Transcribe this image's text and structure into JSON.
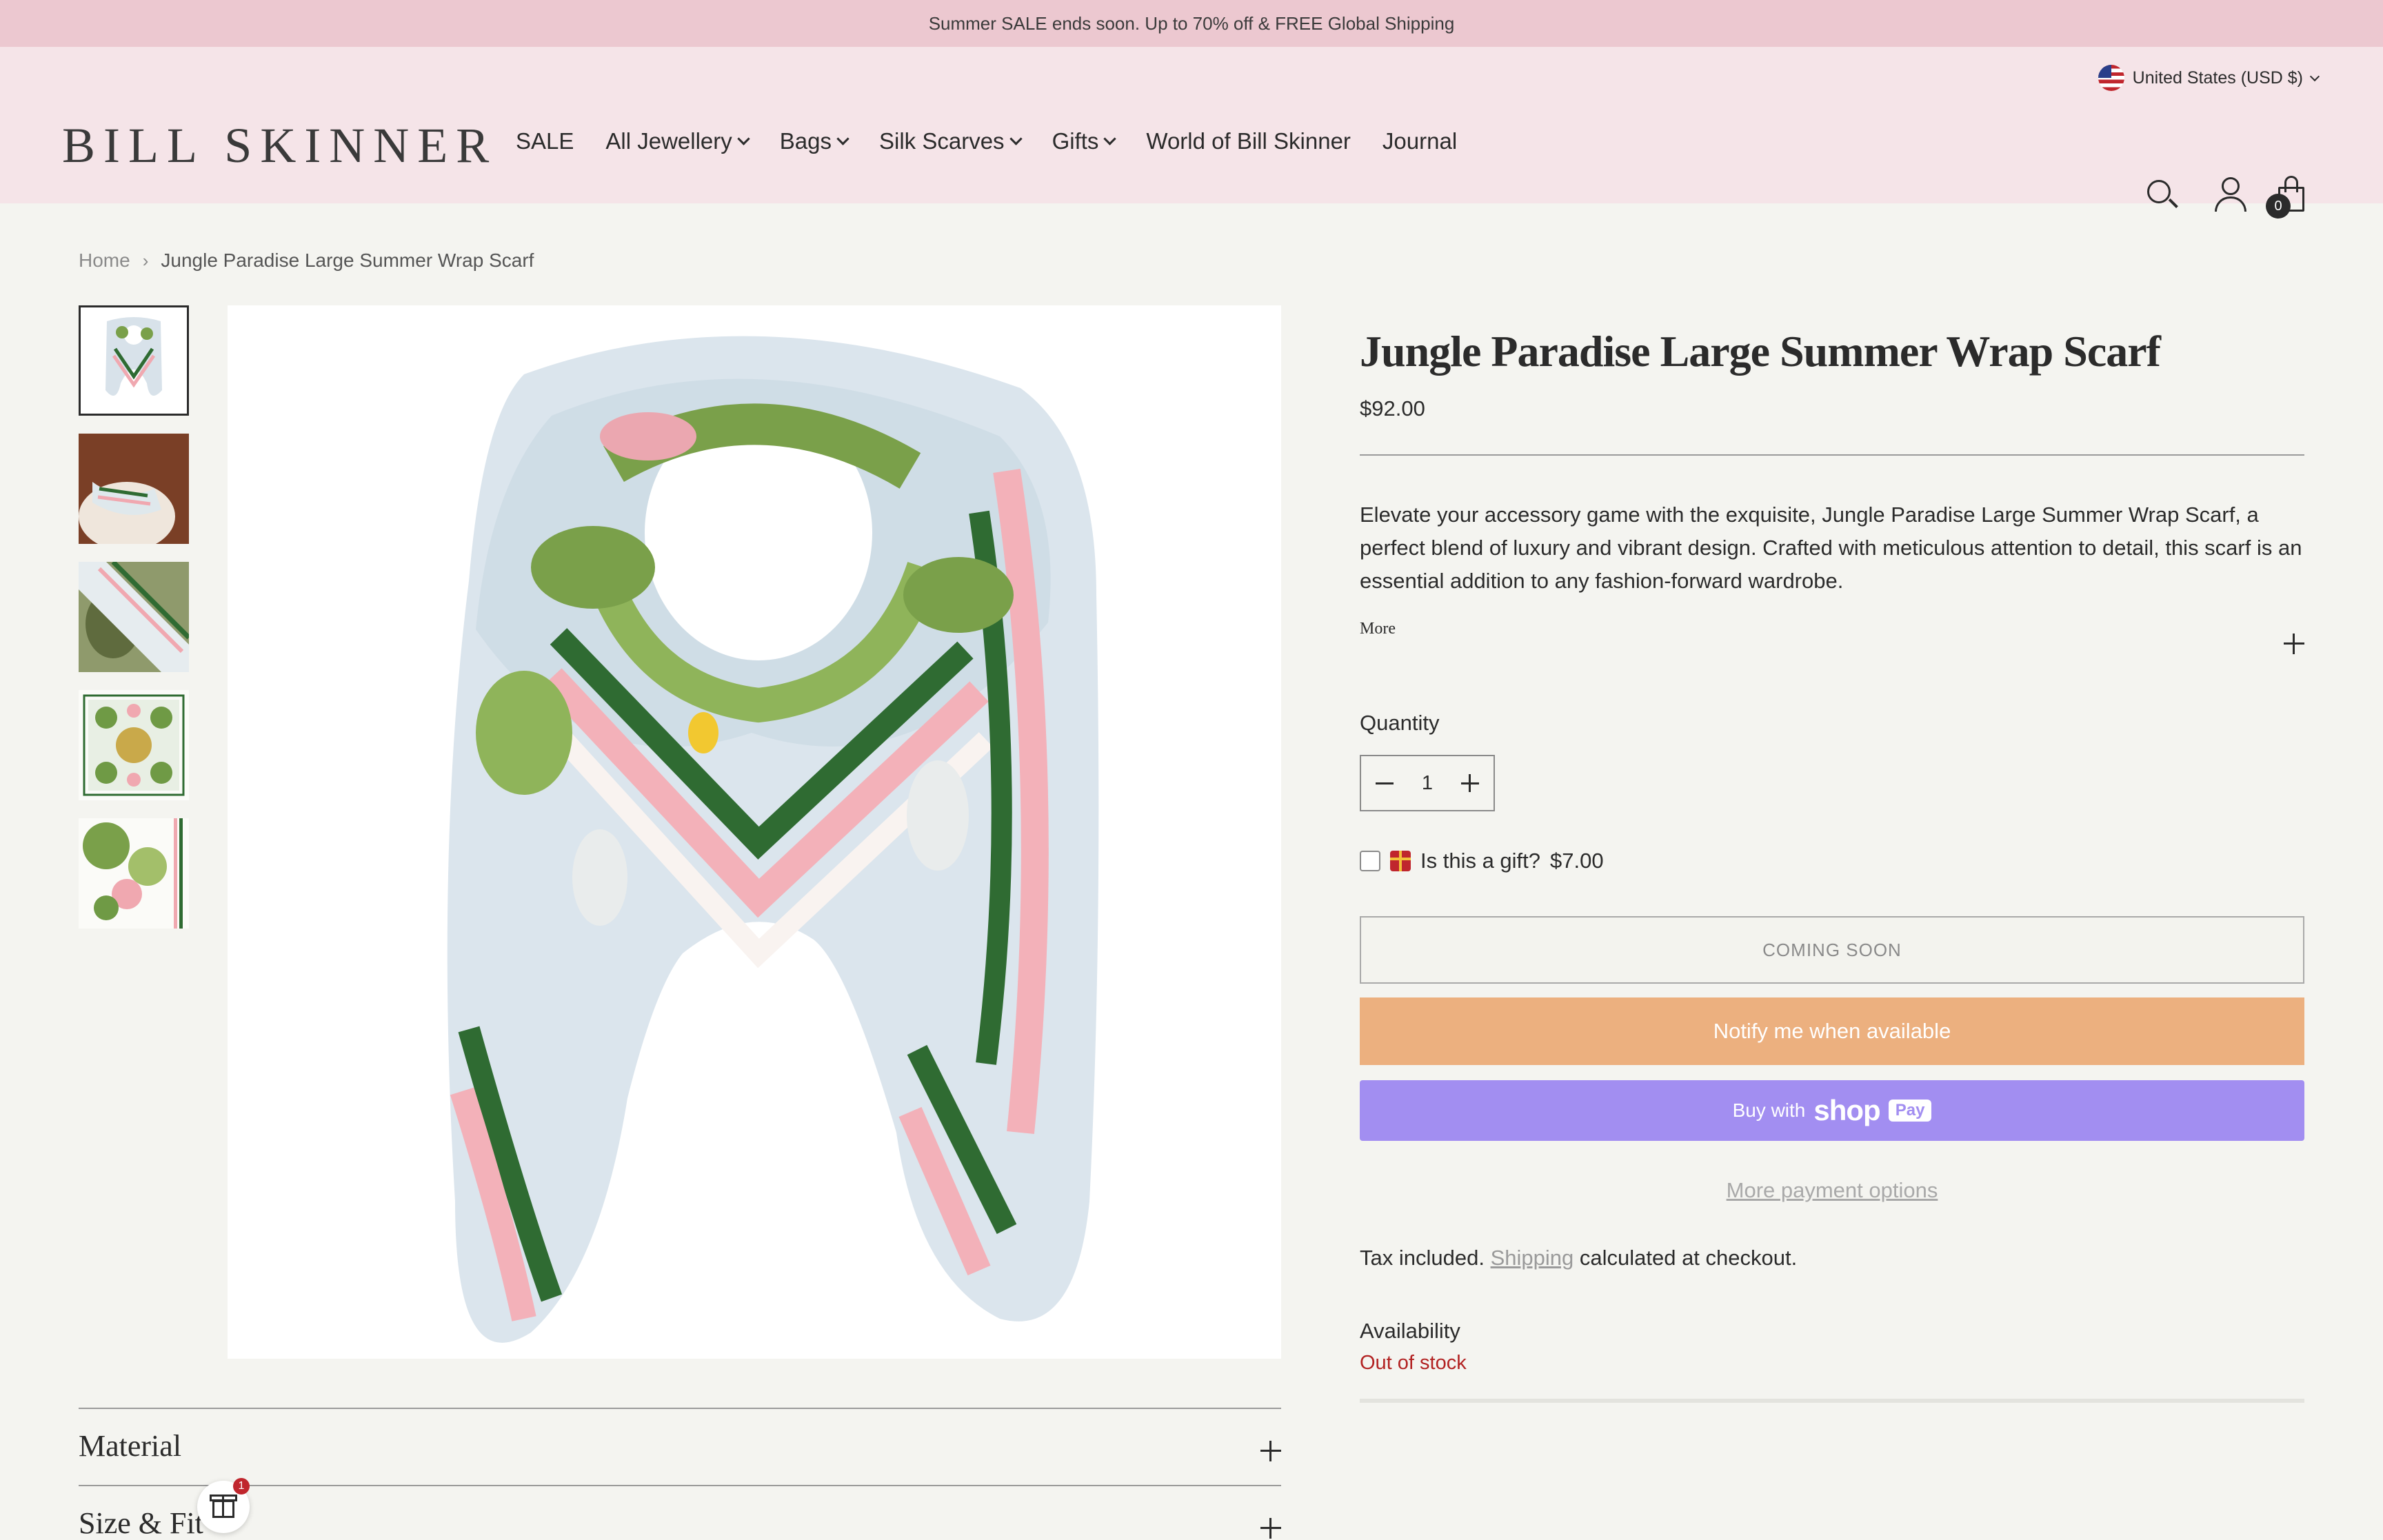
{
  "announcement": "Summer SALE ends soon. Up to 70% off & FREE Global Shipping",
  "header": {
    "locale": "United States (USD $)",
    "logo": "Bill Skinner",
    "nav": [
      {
        "label": "SALE",
        "dropdown": false
      },
      {
        "label": "All Jewellery",
        "dropdown": true
      },
      {
        "label": "Bags",
        "dropdown": true
      },
      {
        "label": "Silk Scarves",
        "dropdown": true
      },
      {
        "label": "Gifts",
        "dropdown": true
      },
      {
        "label": "World of Bill Skinner",
        "dropdown": false
      },
      {
        "label": "Journal",
        "dropdown": false
      }
    ],
    "cart_count": "0"
  },
  "breadcrumb": {
    "home": "Home",
    "current": "Jungle Paradise Large Summer Wrap Scarf"
  },
  "product": {
    "title": "Jungle Paradise Large Summer Wrap Scarf",
    "price": "$92.00",
    "description": "Elevate your accessory game with the exquisite, Jungle Paradise Large Summer Wrap Scarf, a perfect blend of luxury and vibrant design. Crafted with meticulous attention to detail, this scarf is an essential addition to any fashion-forward wardrobe.",
    "more_label": "More",
    "quantity_label": "Quantity",
    "quantity": "1",
    "gift_label": "Is this a gift?",
    "gift_price": "$7.00",
    "coming_soon": "COMING SOON",
    "notify": "Notify me when available",
    "buy_with": "Buy with",
    "shop_word": "shop",
    "pay_badge": "Pay",
    "more_payment": "More payment options",
    "tax_prefix": "Tax included.",
    "tax_link": "Shipping",
    "tax_suffix": "calculated at checkout.",
    "availability_label": "Availability",
    "availability": "Out of stock"
  },
  "accordions": [
    {
      "title": "Material"
    },
    {
      "title": "Size & Fit"
    }
  ],
  "gift_fab_badge": "1",
  "colors": {
    "announcement_bg": "#ecc8d0",
    "header_bg": "#f5e4e8",
    "notify_bg": "#ecb07f",
    "shop_pay_bg": "#a28ef1",
    "out_of_stock": "#b22222"
  }
}
